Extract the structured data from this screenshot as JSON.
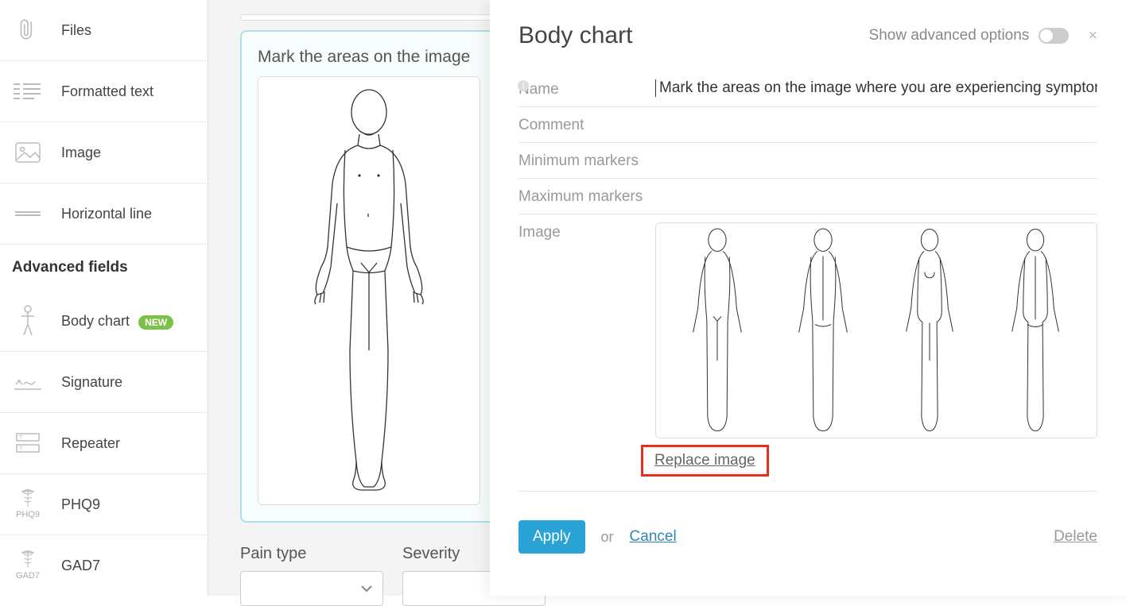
{
  "sidebar": {
    "items": [
      {
        "label": "Files",
        "icon": "paperclip-icon"
      },
      {
        "label": "Formatted text",
        "icon": "lines-icon"
      },
      {
        "label": "Image",
        "icon": "image-icon"
      },
      {
        "label": "Horizontal line",
        "icon": "hr-icon"
      }
    ],
    "advanced_header": "Advanced fields",
    "advanced": [
      {
        "label": "Body chart",
        "icon": "body-icon",
        "badge": "NEW"
      },
      {
        "label": "Signature",
        "icon": "signature-icon"
      },
      {
        "label": "Repeater",
        "icon": "repeater-icon"
      },
      {
        "label": "PHQ9",
        "icon": "caduceus-icon",
        "caption": "PHQ9"
      },
      {
        "label": "GAD7",
        "icon": "caduceus-icon",
        "caption": "GAD7"
      }
    ]
  },
  "main": {
    "card_title": "Mark the areas on the image",
    "pain_type_label": "Pain type",
    "severity_label": "Severity"
  },
  "panel": {
    "title": "Body chart",
    "advanced_label": "Show advanced options",
    "close": "×",
    "fields": {
      "name_label": "Name",
      "name_value": "Mark the areas on the image where you are experiencing sympton",
      "comment_label": "Comment",
      "min_label": "Minimum markers",
      "max_label": "Maximum markers",
      "image_label": "Image",
      "replace_link": "Replace image"
    },
    "footer": {
      "apply": "Apply",
      "or": "or",
      "cancel": "Cancel",
      "delete": "Delete"
    }
  }
}
